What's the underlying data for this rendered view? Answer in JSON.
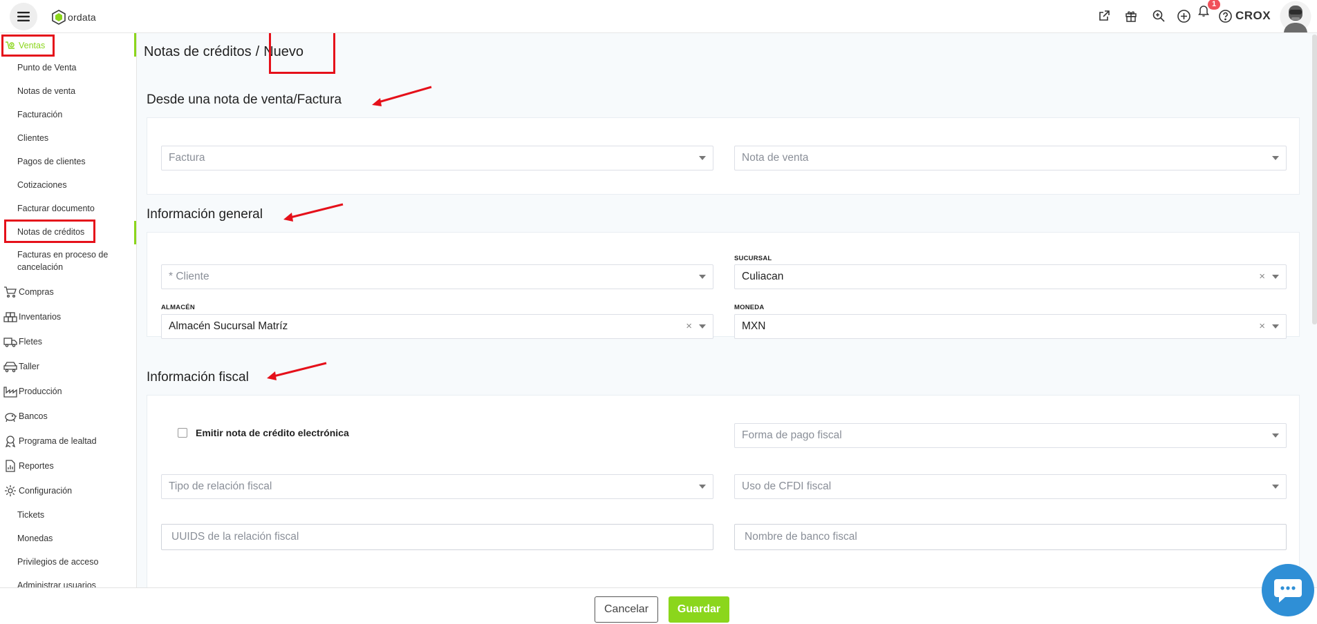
{
  "app": {
    "logo_text": "ordata",
    "brand_name": "CROX",
    "notification_count": "1"
  },
  "top_icons": [
    "external-link-icon",
    "gift-icon",
    "zoom-search-icon",
    "plus-circle-icon",
    "bell-icon",
    "help-icon"
  ],
  "colors": {
    "accent": "#8bd61c",
    "highlight": "#e5101a",
    "chat": "#2f8fd6",
    "badge": "#f0505a"
  },
  "sidebar": {
    "items": [
      {
        "label": "Ventas",
        "type": "main",
        "icon": "sales-icon",
        "active": true
      },
      {
        "label": "Punto de Venta",
        "type": "sub"
      },
      {
        "label": "Notas de venta",
        "type": "sub"
      },
      {
        "label": "Facturación",
        "type": "sub"
      },
      {
        "label": "Clientes",
        "type": "sub"
      },
      {
        "label": "Pagos de clientes",
        "type": "sub"
      },
      {
        "label": "Cotizaciones",
        "type": "sub"
      },
      {
        "label": "Facturar documento",
        "type": "sub"
      },
      {
        "label": "Notas de créditos",
        "type": "sub",
        "active": true
      },
      {
        "label": "Facturas en proceso de",
        "label2": "cancelación",
        "type": "sub"
      },
      {
        "label": "Compras",
        "type": "main",
        "icon": "cart-icon"
      },
      {
        "label": "Inventarios",
        "type": "main",
        "icon": "inventory-icon"
      },
      {
        "label": "Fletes",
        "type": "main",
        "icon": "truck-icon"
      },
      {
        "label": "Taller",
        "type": "main",
        "icon": "workshop-icon"
      },
      {
        "label": "Producción",
        "type": "main",
        "icon": "factory-icon"
      },
      {
        "label": "Bancos",
        "type": "main",
        "icon": "piggy-bank-icon"
      },
      {
        "label": "Programa de lealtad",
        "type": "main",
        "icon": "loyalty-icon"
      },
      {
        "label": "Reportes",
        "type": "main",
        "icon": "report-icon"
      },
      {
        "label": "Configuración",
        "type": "main",
        "icon": "gear-icon"
      },
      {
        "label": "Tickets",
        "type": "sub"
      },
      {
        "label": "Monedas",
        "type": "sub"
      },
      {
        "label": "Privilegios de acceso",
        "type": "sub"
      },
      {
        "label": "Administrar usuarios",
        "type": "sub"
      }
    ]
  },
  "page": {
    "breadcrumb_parent": "Notas de créditos",
    "breadcrumb_sep": "/",
    "breadcrumb_current": "Nuevo"
  },
  "sections": {
    "from_doc": {
      "title": "Desde una nota de venta/Factura",
      "factura_placeholder": "Factura",
      "nota_placeholder": "Nota de venta"
    },
    "general": {
      "title": "Información general",
      "cliente_placeholder": "* Cliente",
      "sucursal_label": "SUCURSAL",
      "sucursal_value": "Culiacan",
      "almacen_label": "ALMACÉN",
      "almacen_value": "Almacén Sucursal Matríz",
      "moneda_label": "MONEDA",
      "moneda_value": "MXN"
    },
    "fiscal": {
      "title": "Información fiscal",
      "emitir_label": "Emitir nota de crédito electrónica",
      "forma_pago_placeholder": "Forma de pago fiscal",
      "tipo_relacion_placeholder": "Tipo de relación fiscal",
      "uso_cfdi_placeholder": "Uso de CFDI fiscal",
      "uuids_placeholder": "UUIDS de la relación fiscal",
      "banco_placeholder": "Nombre de banco fiscal"
    }
  },
  "footer": {
    "cancel_label": "Cancelar",
    "save_label": "Guardar"
  }
}
